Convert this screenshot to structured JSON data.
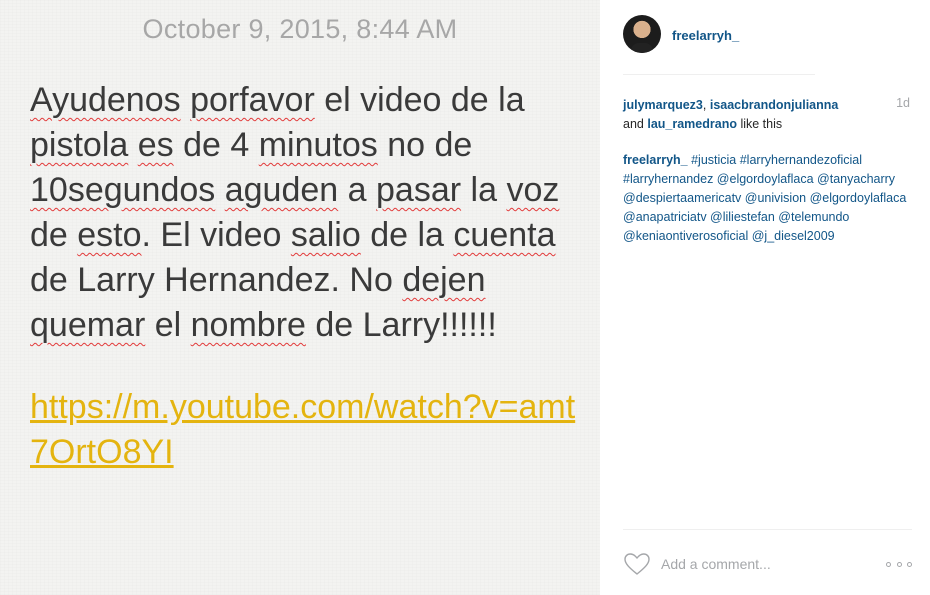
{
  "note": {
    "date": "October 9, 2015, 8:44 AM",
    "body_segments": [
      {
        "text": "Ayudenos",
        "misspelled": true
      },
      {
        "text": " ",
        "misspelled": false
      },
      {
        "text": "porfavor",
        "misspelled": true
      },
      {
        "text": " el video de la ",
        "misspelled": false
      },
      {
        "text": "pistola",
        "misspelled": true
      },
      {
        "text": " ",
        "misspelled": false
      },
      {
        "text": "es",
        "misspelled": true
      },
      {
        "text": " de 4 ",
        "misspelled": false
      },
      {
        "text": "minutos",
        "misspelled": true
      },
      {
        "text": " no de ",
        "misspelled": false
      },
      {
        "text": "10segundos",
        "misspelled": true
      },
      {
        "text": " ",
        "misspelled": false
      },
      {
        "text": "aguden",
        "misspelled": true
      },
      {
        "text": " a ",
        "misspelled": false
      },
      {
        "text": "pasar",
        "misspelled": true
      },
      {
        "text": " la ",
        "misspelled": false
      },
      {
        "text": "voz",
        "misspelled": true
      },
      {
        "text": " de ",
        "misspelled": false
      },
      {
        "text": "esto",
        "misspelled": true
      },
      {
        "text": ". El video ",
        "misspelled": false
      },
      {
        "text": "salio",
        "misspelled": true
      },
      {
        "text": " de la ",
        "misspelled": false
      },
      {
        "text": "cuenta",
        "misspelled": true
      },
      {
        "text": " de Larry Hernandez. No ",
        "misspelled": false
      },
      {
        "text": "dejen",
        "misspelled": true
      },
      {
        "text": " ",
        "misspelled": false
      },
      {
        "text": "quemar",
        "misspelled": true
      },
      {
        "text": " el ",
        "misspelled": false
      },
      {
        "text": "nombre",
        "misspelled": true
      },
      {
        "text": " de Larry!!!!!!",
        "misspelled": false
      }
    ],
    "link": "https://m.youtube.com/watch?v=amt7OrtO8YI"
  },
  "post": {
    "username": "freelarryh_",
    "likes": {
      "users": [
        "julymarquez3",
        "isaacbrandonjulianna",
        "lau_ramedrano"
      ],
      "sep1": ", ",
      "sep2": "and ",
      "suffix": " like this",
      "time": "1d"
    },
    "caption": {
      "author": "freelarryh_",
      "text": " #justicia #larryhernandezoficial #larryhernandez @elgordoylaflaca @tanyacharry @despiertaamericatv @univision @elgordoylaflaca @anapatriciatv @liliestefan @telemundo @keniaontiverosoficial @j_diesel2009"
    },
    "comment_placeholder": "Add a comment...",
    "icons": {
      "like": "heart-icon",
      "more": "more-options-icon"
    }
  },
  "colors": {
    "link_blue": "#125688",
    "note_link": "#e4b40f",
    "muted": "#a5a7aa",
    "spellcheck": "#e23a3a"
  }
}
